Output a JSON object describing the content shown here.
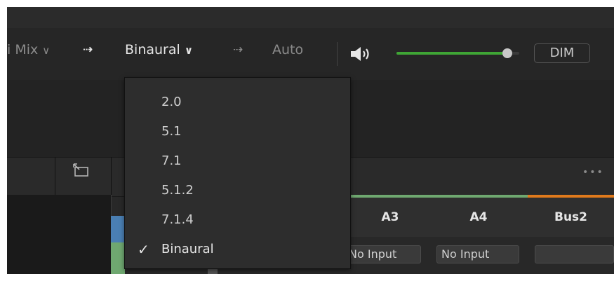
{
  "toolbar": {
    "partial_label": "i Mix",
    "partial_chevron": "∨",
    "arrow1": "⇢",
    "format_label": "Binaural",
    "format_chevron": "∨",
    "arrow2": "⇢",
    "auto_label": "Auto",
    "speaker_icon": "speaker-icon",
    "dim_label": "DIM",
    "volume_level": 0.94,
    "volume_color": "#3fa535"
  },
  "format_menu": {
    "items": [
      "2.0",
      "5.1",
      "7.1",
      "5.1.2",
      "7.1.4",
      "Binaural"
    ],
    "checked": "Binaural",
    "check_glyph": "✓"
  },
  "header_row": {
    "more_label": "•••",
    "expand_icon": "expand-window-icon"
  },
  "channels": [
    {
      "name": "A3",
      "input": "No Input",
      "stripe_color": "#6fa870"
    },
    {
      "name": "A4",
      "input": "No Input",
      "stripe_color": "#6fa870"
    },
    {
      "name": "Bus2",
      "input": "",
      "stripe_color": "#e07a1c"
    }
  ]
}
